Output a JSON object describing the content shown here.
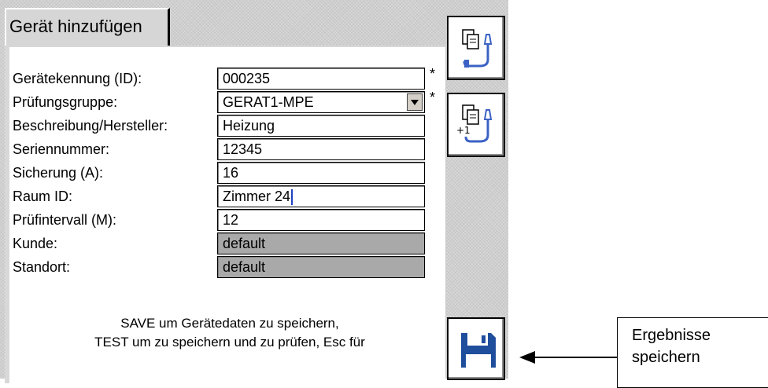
{
  "window": {
    "tab_title": "Gerät hinzufügen"
  },
  "form": {
    "fields": [
      {
        "label": "Gerätekennung (ID):",
        "value": "000235",
        "required": "*"
      },
      {
        "label": "Prüfungsgruppe:",
        "value": "GERAT1-MPE",
        "required": "*"
      },
      {
        "label": "Beschreibung/Hersteller:",
        "value": "Heizung"
      },
      {
        "label": "Seriennummer:",
        "value": "12345"
      },
      {
        "label": "Sicherung (A):",
        "value": "16"
      },
      {
        "label": "Raum ID:",
        "value": "Zimmer 24"
      },
      {
        "label": "Prüfintervall (M):",
        "value": "12"
      },
      {
        "label": "Kunde:",
        "value": "default"
      },
      {
        "label": "Standort:",
        "value": "default"
      }
    ]
  },
  "info": {
    "line1": "SAVE um Gerätedaten zu speichern,",
    "line2": "TEST um zu speichern und zu prüfen, Esc für"
  },
  "sidebar": {
    "copy_icon": "copy-plug-icon",
    "copy_increment_icon": "copy-plug-increment-icon",
    "increment_label": "+1",
    "save_icon": "floppy-disk-icon"
  },
  "annotation": {
    "line1": "Ergebnisse",
    "line2": "speichern"
  },
  "colors": {
    "floppy": "#1f4e9c",
    "plug": "#3b62c4",
    "readonly": "#a9a9a9"
  }
}
